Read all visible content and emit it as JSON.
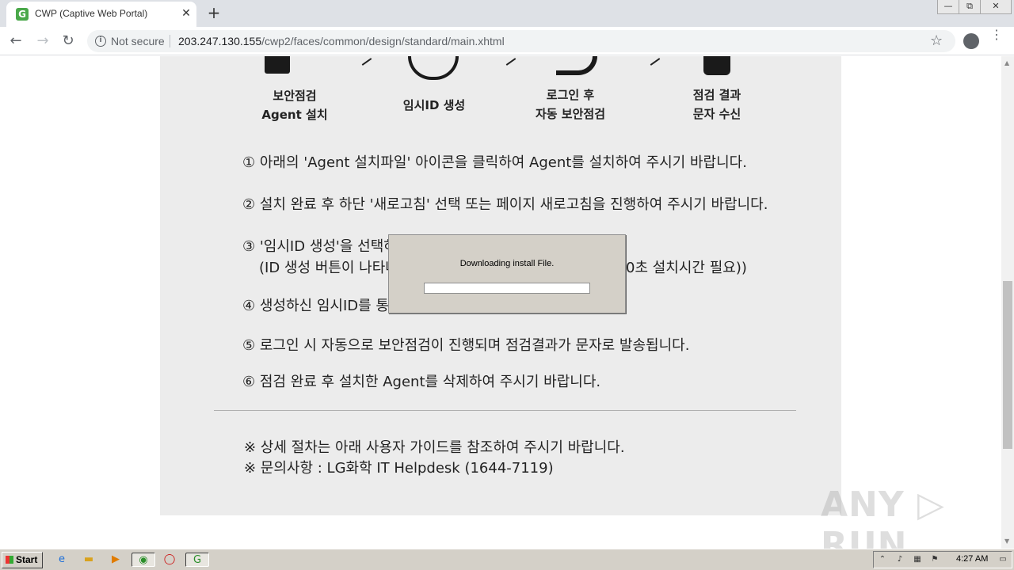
{
  "browser": {
    "tab_title": "CWP (Captive Web Portal)",
    "tab_favicon": "G",
    "tab_close": "✕",
    "new_tab": "+",
    "window_minimize": "—",
    "window_restore": "⧉",
    "window_close": "✕",
    "back": "←",
    "forward": "→",
    "reload": "↻",
    "info_icon": "i",
    "not_secure": "Not secure",
    "url_host": "203.247.130.155",
    "url_path": "/cwp2/faces/common/design/standard/main.xhtml",
    "star": "☆",
    "menu": "⋮"
  },
  "steps": [
    {
      "line1": "보안점검",
      "line2": "Agent 설치"
    },
    {
      "line1": "임시ID 생성",
      "line2": ""
    },
    {
      "line1": "로그인 후",
      "line2": "자동 보안점검"
    },
    {
      "line1": "점검 결과",
      "line2": "문자 수신"
    }
  ],
  "instructions": [
    "① 아래의 'Agent 설치파일' 아이콘을 클릭하여 Agent를 설치하여 주시기 바랍니다.",
    "② 설치 완료 후 하단 '새로고침' 선택 또는 페이지 새로고침을 진행하여 주시기 바랍니다.",
    "③ '임시ID 생성'을 선택하",
    "(ID 생성 버튼이 나타나",
    "0초 설치시간 필요))",
    "④ 생성하신 임시ID를 통",
    "⑤ 로그인 시 자동으로 보안점검이 진행되며 점검결과가 문자로 발송됩니다.",
    "⑥ 점검 완료 후 설치한 Agent를 삭제하여 주시기 바랍니다."
  ],
  "notes": [
    "※ 상세 절차는 아래 사용자 가이드를 참조하여 주시기 바랍니다.",
    "※ 문의사항 : LG화학 IT Helpdesk (1644-7119)"
  ],
  "dialog": {
    "message": "Downloading install File.",
    "progress": 0
  },
  "watermark": "ANY ▷ RUN",
  "taskbar": {
    "start_label": "Start",
    "clock": "4:27 AM"
  },
  "colors": {
    "content_bg": "#ececec",
    "dialog_bg": "#d4d0c8",
    "taskbar_bg": "#d4d0c8"
  }
}
